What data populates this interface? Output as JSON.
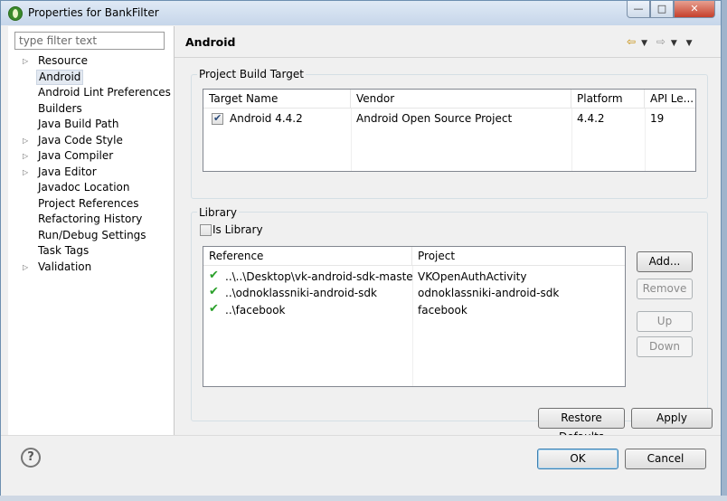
{
  "window": {
    "title": "Properties for BankFilter"
  },
  "filter": {
    "placeholder": "type filter text"
  },
  "tree": [
    {
      "label": "Resource",
      "expandable": true,
      "selected": false
    },
    {
      "label": "Android",
      "expandable": false,
      "selected": true
    },
    {
      "label": "Android Lint Preferences",
      "expandable": false,
      "selected": false
    },
    {
      "label": "Builders",
      "expandable": false,
      "selected": false
    },
    {
      "label": "Java Build Path",
      "expandable": false,
      "selected": false
    },
    {
      "label": "Java Code Style",
      "expandable": true,
      "selected": false
    },
    {
      "label": "Java Compiler",
      "expandable": true,
      "selected": false
    },
    {
      "label": "Java Editor",
      "expandable": true,
      "selected": false
    },
    {
      "label": "Javadoc Location",
      "expandable": false,
      "selected": false
    },
    {
      "label": "Project References",
      "expandable": false,
      "selected": false
    },
    {
      "label": "Refactoring History",
      "expandable": false,
      "selected": false
    },
    {
      "label": "Run/Debug Settings",
      "expandable": false,
      "selected": false
    },
    {
      "label": "Task Tags",
      "expandable": false,
      "selected": false
    },
    {
      "label": "Validation",
      "expandable": true,
      "selected": false
    }
  ],
  "page": {
    "title": "Android"
  },
  "build_target": {
    "group_label": "Project Build Target",
    "columns": [
      "Target Name",
      "Vendor",
      "Platform",
      "API Le..."
    ],
    "rows": [
      {
        "checked": true,
        "name": "Android 4.4.2",
        "vendor": "Android Open Source Project",
        "platform": "4.4.2",
        "api": "19"
      }
    ]
  },
  "library": {
    "group_label": "Library",
    "is_library_label": "Is Library",
    "is_library_checked": false,
    "columns": [
      "Reference",
      "Project"
    ],
    "rows": [
      {
        "reference": "..\\..\\Desktop\\vk-android-sdk-master...",
        "project": "VKOpenAuthActivity"
      },
      {
        "reference": "..\\odnoklassniki-android-sdk",
        "project": "odnoklassniki-android-sdk"
      },
      {
        "reference": "..\\facebook",
        "project": "facebook"
      }
    ],
    "buttons": {
      "add": "Add...",
      "remove": "Remove",
      "up": "Up",
      "down": "Down"
    }
  },
  "actions": {
    "restore_defaults": "Restore Defaults",
    "apply": "Apply",
    "ok": "OK",
    "cancel": "Cancel",
    "help": "?"
  },
  "colors": {
    "accent": "#3c7fb1",
    "check": "#2aa02a",
    "selection": "#e3e9f1"
  },
  "icons": {
    "app": "eclipse-icon",
    "back": "back-arrow-icon",
    "forward": "forward-arrow-icon",
    "menu": "view-menu-icon"
  }
}
